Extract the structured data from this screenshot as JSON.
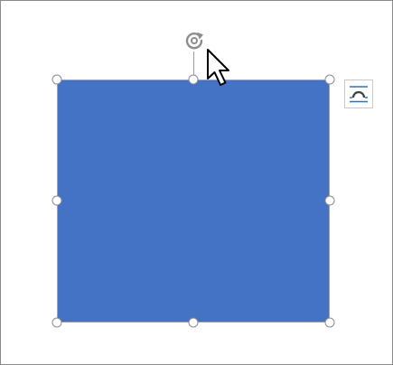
{
  "shape": {
    "kind": "rectangle",
    "fill": "#4472c4",
    "outline": "#2f528f",
    "selected": true
  },
  "selection": {
    "handle_color": "#8c8c8c",
    "handles": [
      "top-left",
      "top-center",
      "top-right",
      "middle-left",
      "middle-right",
      "bottom-left",
      "bottom-center",
      "bottom-right"
    ]
  },
  "rotate_handle": {
    "icon": "rotate-icon",
    "color": "#8c8c8c"
  },
  "layout_options": {
    "icon": "wrap-text-icon",
    "accent": "#2e75b6"
  },
  "pointer": {
    "icon": "arrow-cursor-icon"
  }
}
